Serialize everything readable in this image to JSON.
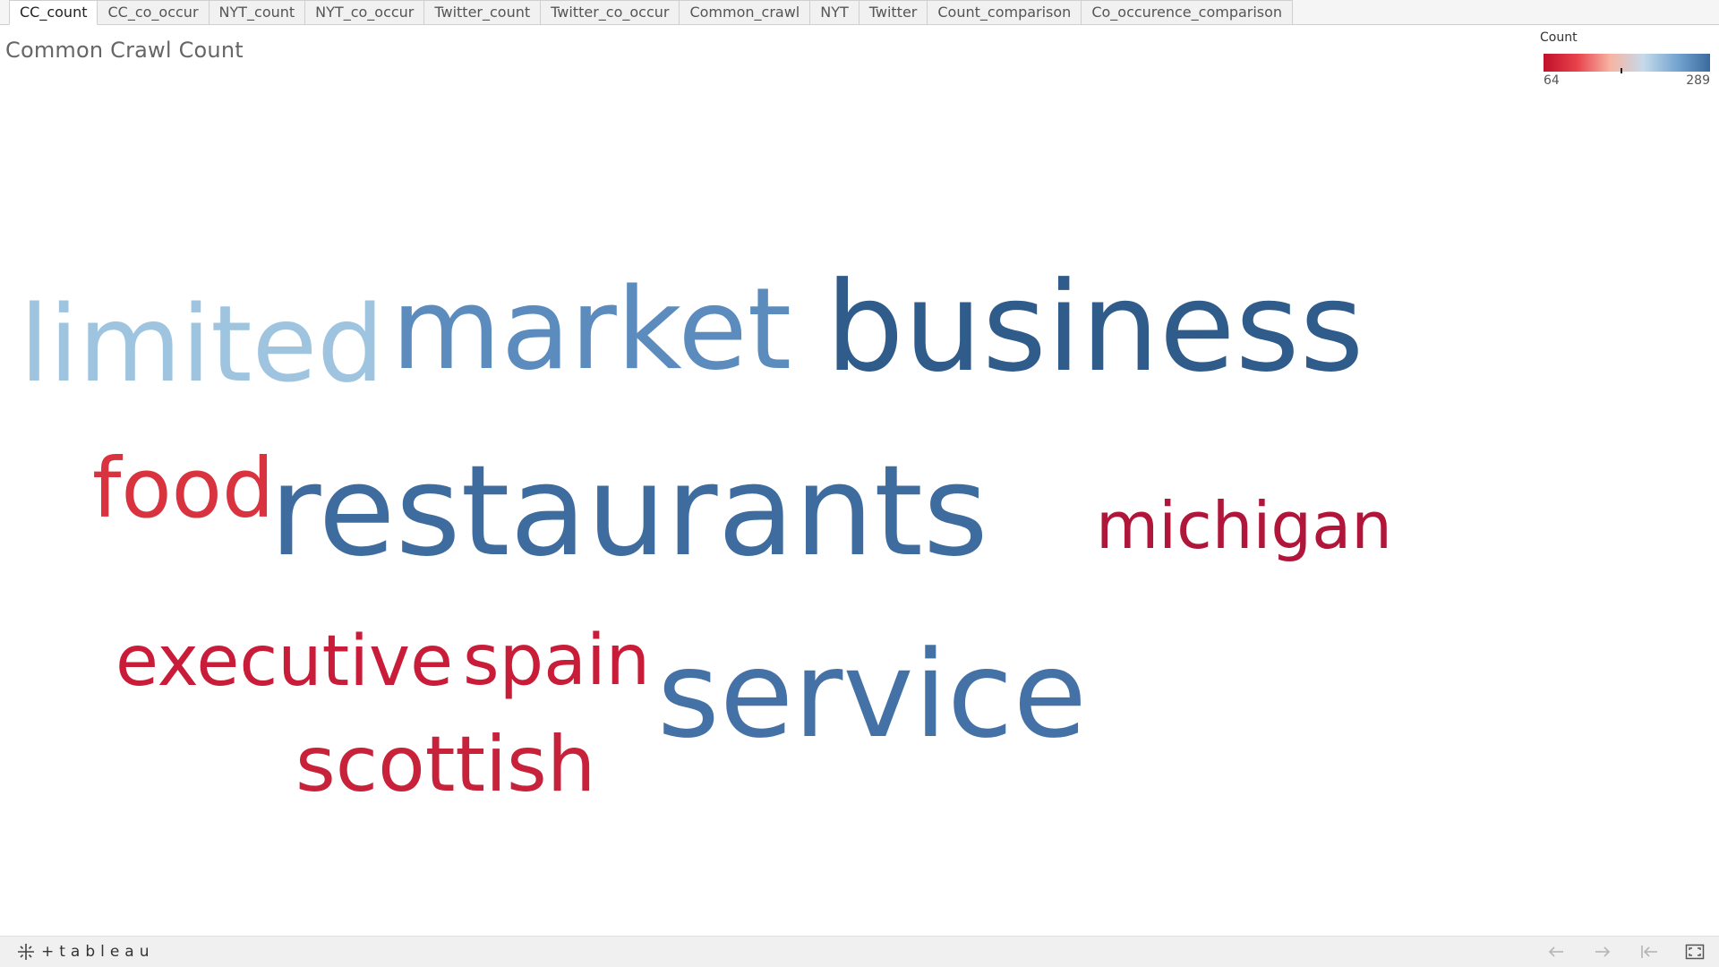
{
  "tabs": [
    {
      "label": "CC_count",
      "active": true
    },
    {
      "label": "CC_co_occur",
      "active": false
    },
    {
      "label": "NYT_count",
      "active": false
    },
    {
      "label": "NYT_co_occur",
      "active": false
    },
    {
      "label": "Twitter_count",
      "active": false
    },
    {
      "label": "Twitter_co_occur",
      "active": false
    },
    {
      "label": "Common_crawl",
      "active": false
    },
    {
      "label": "NYT",
      "active": false
    },
    {
      "label": "Twitter",
      "active": false
    },
    {
      "label": "Count_comparison",
      "active": false
    },
    {
      "label": "Co_occurence_comparison",
      "active": false
    }
  ],
  "sheet": {
    "title": "Common Crawl Count"
  },
  "legend": {
    "title": "Count",
    "min": "64",
    "max": "289",
    "colors": [
      "#c0102b",
      "#e8414b",
      "#f7b4a3",
      "#c5daea",
      "#75a5d0",
      "#3a6b9e"
    ]
  },
  "word_cloud": {
    "words": [
      {
        "text": "limited",
        "color": "#9ec4e0"
      },
      {
        "text": "market",
        "color": "#5b8cbd"
      },
      {
        "text": "business",
        "color": "#2f5c8a"
      },
      {
        "text": "food",
        "color": "#d8333f"
      },
      {
        "text": "restaurants",
        "color": "#3e6c9e"
      },
      {
        "text": "michigan",
        "color": "#b0163a"
      },
      {
        "text": "executive",
        "color": "#c81c39"
      },
      {
        "text": "spain",
        "color": "#c81c39"
      },
      {
        "text": "service",
        "color": "#4572a6"
      },
      {
        "text": "scottish",
        "color": "#c8223a"
      }
    ]
  },
  "footer": {
    "brand": "tableau",
    "icons": [
      "undo-icon",
      "redo-icon",
      "revert-icon",
      "fullscreen-icon"
    ]
  }
}
